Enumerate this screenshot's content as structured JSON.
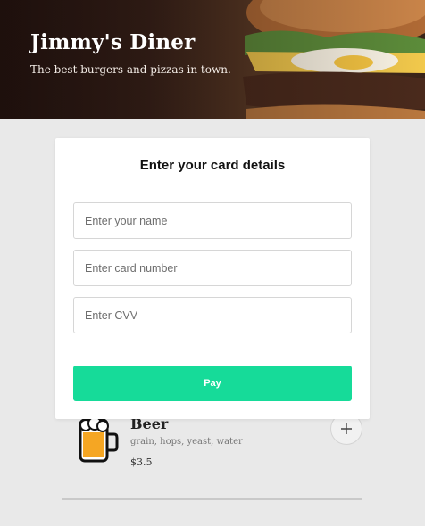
{
  "header": {
    "title": "Jimmy's Diner",
    "subtitle": "The best burgers and pizzas in town."
  },
  "modal": {
    "title": "Enter your card details",
    "name_placeholder": "Enter your name",
    "card_placeholder": "Enter card number",
    "cvv_placeholder": "Enter CVV",
    "pay_label": "Pay"
  },
  "menu": {
    "items": [
      {
        "emoji": "beer-mug-icon",
        "name": "Beer",
        "ingredients": "grain, hops, yeast, water",
        "price": "$3.5"
      }
    ]
  },
  "colors": {
    "accent": "#16db99",
    "background": "#e9e9e9"
  }
}
